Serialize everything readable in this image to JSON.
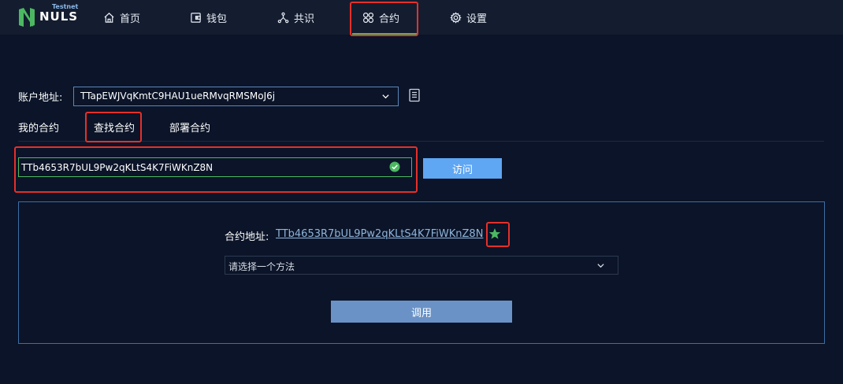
{
  "brand": {
    "name": "NULS",
    "badge": "Testnet"
  },
  "nav": {
    "items": [
      {
        "label": "首页",
        "icon": "home-icon"
      },
      {
        "label": "钱包",
        "icon": "wallet-icon"
      },
      {
        "label": "共识",
        "icon": "consensus-icon"
      },
      {
        "label": "合约",
        "icon": "contract-icon",
        "active": true
      },
      {
        "label": "设置",
        "icon": "gear-icon"
      }
    ]
  },
  "account": {
    "label": "账户地址:",
    "value": "TTapEWJVqKmtC9HAU1ueRMvqRMSMoJ6j"
  },
  "tabs": [
    {
      "label": "我的合约"
    },
    {
      "label": "查找合约",
      "active": true
    },
    {
      "label": "部署合约"
    }
  ],
  "search": {
    "value": "TTb4653R7bUL9Pw2qKLtS4K7FiWKnZ8N"
  },
  "visit_button": "访问",
  "contract": {
    "address_label": "合约地址:",
    "address": "TTb4653R7bUL9Pw2qKLtS4K7FiWKnZ8N",
    "method_placeholder": "请选择一个方法",
    "call_button": "调用"
  },
  "colors": {
    "background": "#0b1428",
    "topbar": "#141d2f",
    "accent_green": "#4cb862",
    "button_blue": "#5fa6f3",
    "call_button": "#6a92c6",
    "highlight_red": "#e5302a"
  }
}
